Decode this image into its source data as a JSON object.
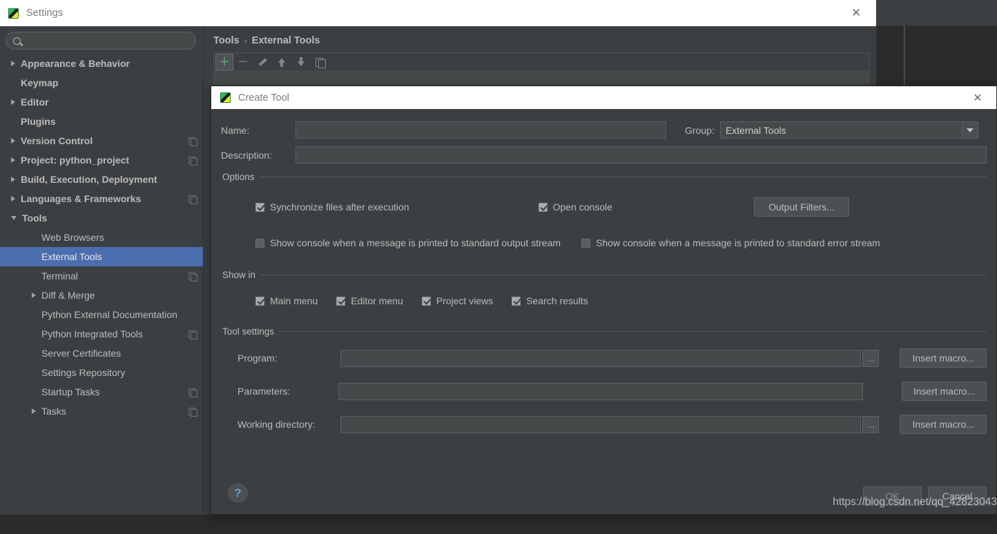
{
  "settings_window": {
    "title": "Settings",
    "close_label": "✕",
    "search": {
      "placeholder": "",
      "value": "",
      "icon": "search-icon"
    },
    "sidebar_items": [
      {
        "label": "Appearance & Behavior",
        "arrow": "right",
        "bold": true,
        "indent": 0,
        "badge": false,
        "selected": false
      },
      {
        "label": "Keymap",
        "arrow": "none",
        "bold": true,
        "indent": 0,
        "badge": false,
        "selected": false
      },
      {
        "label": "Editor",
        "arrow": "right",
        "bold": true,
        "indent": 0,
        "badge": false,
        "selected": false
      },
      {
        "label": "Plugins",
        "arrow": "none",
        "bold": true,
        "indent": 0,
        "badge": false,
        "selected": false
      },
      {
        "label": "Version Control",
        "arrow": "right",
        "bold": true,
        "indent": 0,
        "badge": true,
        "selected": false
      },
      {
        "label": "Project: python_project",
        "arrow": "right",
        "bold": true,
        "indent": 0,
        "badge": true,
        "selected": false
      },
      {
        "label": "Build, Execution, Deployment",
        "arrow": "right",
        "bold": true,
        "indent": 0,
        "badge": false,
        "selected": false
      },
      {
        "label": "Languages & Frameworks",
        "arrow": "right",
        "bold": true,
        "indent": 0,
        "badge": true,
        "selected": false
      },
      {
        "label": "Tools",
        "arrow": "down",
        "bold": true,
        "indent": 0,
        "badge": false,
        "selected": false
      },
      {
        "label": "Web Browsers",
        "arrow": "none",
        "bold": false,
        "indent": 1,
        "badge": false,
        "selected": false
      },
      {
        "label": "External Tools",
        "arrow": "none",
        "bold": false,
        "indent": 1,
        "badge": false,
        "selected": true
      },
      {
        "label": "Terminal",
        "arrow": "none",
        "bold": false,
        "indent": 1,
        "badge": true,
        "selected": false
      },
      {
        "label": "Diff & Merge",
        "arrow": "right",
        "bold": false,
        "indent": 1,
        "badge": false,
        "selected": false
      },
      {
        "label": "Python External Documentation",
        "arrow": "none",
        "bold": false,
        "indent": 1,
        "badge": false,
        "selected": false
      },
      {
        "label": "Python Integrated Tools",
        "arrow": "none",
        "bold": false,
        "indent": 1,
        "badge": true,
        "selected": false
      },
      {
        "label": "Server Certificates",
        "arrow": "none",
        "bold": false,
        "indent": 1,
        "badge": false,
        "selected": false
      },
      {
        "label": "Settings Repository",
        "arrow": "none",
        "bold": false,
        "indent": 1,
        "badge": false,
        "selected": false
      },
      {
        "label": "Startup Tasks",
        "arrow": "none",
        "bold": false,
        "indent": 1,
        "badge": true,
        "selected": false
      },
      {
        "label": "Tasks",
        "arrow": "right",
        "bold": false,
        "indent": 1,
        "badge": true,
        "selected": false
      }
    ],
    "breadcrumb": {
      "root": "Tools",
      "separator": "›",
      "current": "External Tools"
    },
    "toolbar": [
      {
        "name": "add-tool-button",
        "icon": "plus-icon",
        "active": true
      },
      {
        "name": "remove-tool-button",
        "icon": "minus-icon",
        "active": false
      },
      {
        "name": "edit-tool-button",
        "icon": "pencil-icon",
        "active": false
      },
      {
        "name": "move-up-button",
        "icon": "arrow-up-icon",
        "active": false
      },
      {
        "name": "move-down-button",
        "icon": "arrow-down-icon",
        "active": false
      },
      {
        "name": "copy-tool-button",
        "icon": "copy-icon",
        "active": false
      }
    ]
  },
  "create_tool_dialog": {
    "title": "Create Tool",
    "close_label": "✕",
    "fields": {
      "name_label": "Name:",
      "name_value": "",
      "description_label": "Description:",
      "description_value": "",
      "group_label": "Group:",
      "group_value": "External Tools"
    },
    "options": {
      "title": "Options",
      "checkboxes": [
        {
          "label": "Synchronize files after execution",
          "checked": true
        },
        {
          "label": "Open console",
          "checked": true
        },
        {
          "label": "Show console when a message is printed to standard output stream",
          "checked": false
        },
        {
          "label": "Show console when a message is printed to standard error stream",
          "checked": false
        }
      ],
      "output_filters_button": "Output Filters..."
    },
    "show_in": {
      "title": "Show in",
      "checkboxes": [
        {
          "label": "Main menu",
          "checked": true
        },
        {
          "label": "Editor menu",
          "checked": true
        },
        {
          "label": "Project views",
          "checked": true
        },
        {
          "label": "Search results",
          "checked": true
        }
      ]
    },
    "tool_settings": {
      "title": "Tool settings",
      "rows": [
        {
          "label": "Program:",
          "value": "",
          "has_browse": true,
          "macro_button": "Insert macro..."
        },
        {
          "label": "Parameters:",
          "value": "",
          "has_browse": false,
          "macro_button": "Insert macro..."
        },
        {
          "label": "Working directory:",
          "value": "",
          "has_browse": true,
          "macro_button": "Insert macro..."
        }
      ],
      "browse_label": "..."
    },
    "help_label": "?",
    "ok_label": "OK",
    "cancel_label": "Cancel"
  },
  "watermark": "https://blog.csdn.net/qq_42823043",
  "colors": {
    "selection_blue": "#4b6eaf",
    "plus_green": "#59a869",
    "help_blue": "#61a6d8",
    "panel_bg": "#3c3f41",
    "field_bg": "#45494a",
    "text": "#bbbbbb"
  }
}
